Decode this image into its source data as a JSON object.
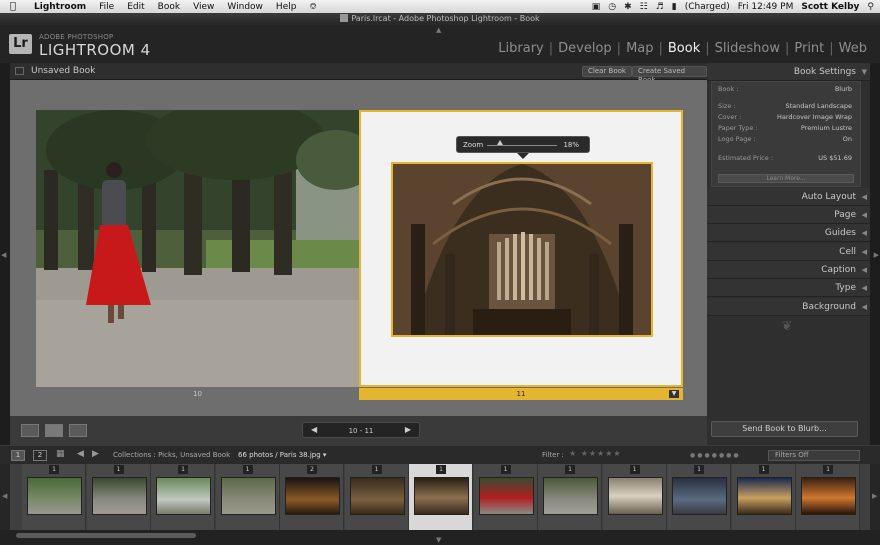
{
  "menubar": {
    "app": "Lightroom",
    "items": [
      "File",
      "Edit",
      "Book",
      "View",
      "Window",
      "Help"
    ],
    "battery": "(Charged)",
    "clock": "Fri 12:49 PM",
    "user": "Scott Kelby"
  },
  "window": {
    "title": "Paris.lrcat - Adobe Photoshop Lightroom - Book"
  },
  "identity": {
    "logo": "Lr",
    "vendor": "ADOBE PHOTOSHOP",
    "product": "LIGHTROOM 4"
  },
  "modules": [
    "Library",
    "Develop",
    "Map",
    "Book",
    "Slideshow",
    "Print",
    "Web"
  ],
  "active_module": "Book",
  "work": {
    "title": "Unsaved Book",
    "clear_label": "Clear Book",
    "save_label": "Create Saved Book",
    "left_page_number": "10",
    "right_page_number": "11",
    "page_range": "10  -  11"
  },
  "zoom": {
    "label": "Zoom",
    "value": "18%",
    "fraction": 0.18
  },
  "settings": {
    "header": "Book Settings",
    "book_label": "Book :",
    "book_value": "Blurb",
    "rows": [
      {
        "label": "Size :",
        "value": "Standard Landscape"
      },
      {
        "label": "Cover :",
        "value": "Hardcover Image Wrap"
      },
      {
        "label": "Paper Type :",
        "value": "Premium Lustre"
      },
      {
        "label": "Logo Page :",
        "value": "On"
      }
    ],
    "price_label": "Estimated Price :",
    "price_value": "US $51.69",
    "learn_more": "Learn More..."
  },
  "panels": [
    "Auto Layout",
    "Page",
    "Guides",
    "Cell",
    "Caption",
    "Type",
    "Background"
  ],
  "send_button": "Send Book to Blurb...",
  "filmstrip": {
    "page1": "1",
    "page2": "2",
    "source": "Collections : Picks, Unsaved Book",
    "count": "66 photos",
    "current_file": "/ Paris 38.jpg",
    "filter_label": "Filter :",
    "filter_value": "Filters Off",
    "badges": [
      "1",
      "1",
      "1",
      "1",
      "2",
      "1",
      "1",
      "1",
      "1",
      "1",
      "1",
      "1",
      "1"
    ],
    "selected_index": 6
  },
  "colors": {
    "accent": "#e4b52f",
    "background": "#1a1a1a",
    "panel": "#2f2f2f"
  }
}
